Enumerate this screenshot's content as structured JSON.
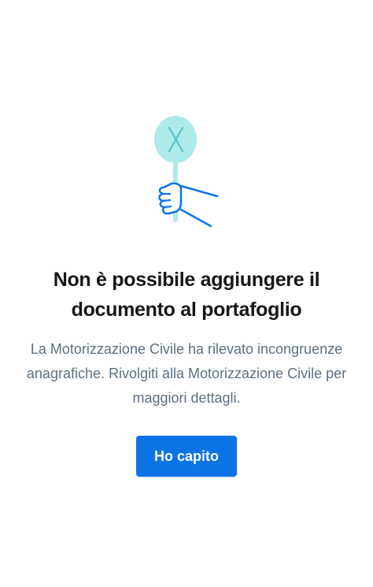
{
  "illustration": {
    "icon": "hand-holding-rejected-sign-icon",
    "sign_color": "#aeeaea",
    "line_color": "#0b73e6"
  },
  "error": {
    "title": "Non è possibile aggiungere il documento al portafoglio",
    "description": "La Motorizzazione Civile ha rilevato incongruenze anagrafiche. Rivolgiti alla Motorizzazione Civile per maggiori dettagli."
  },
  "actions": {
    "confirm_label": "Ho capito"
  },
  "colors": {
    "primary": "#0b73e6",
    "title": "#17171a",
    "body": "#5c6f82",
    "background": "#ffffff"
  }
}
